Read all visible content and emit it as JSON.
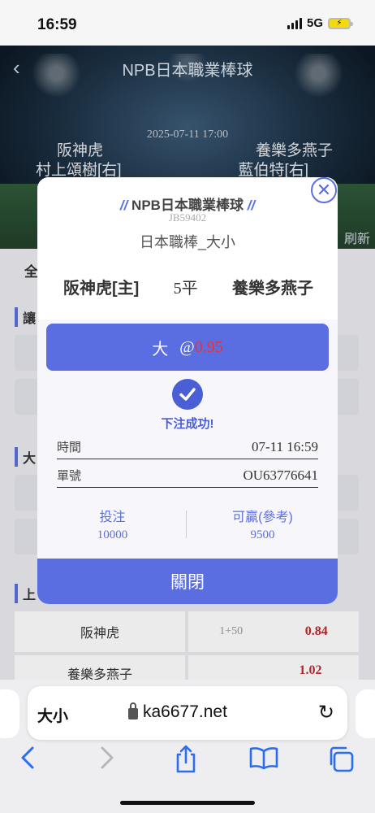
{
  "status": {
    "time": "16:59",
    "network": "5G"
  },
  "header": {
    "title": "NPB日本職業棒球",
    "date": "2025-07-11 17:00",
    "home_team": "阪神虎",
    "home_pitcher": "村上頌樹[右]",
    "away_team": "養樂多燕子",
    "away_pitcher": "藍伯特[右]",
    "refresh": "刷新"
  },
  "page": {
    "tab_all": "全",
    "section1": "讓",
    "section2": "大",
    "section3": "上",
    "row1": {
      "team": "阪神虎",
      "handicap": "1+50",
      "odds": "0.84"
    },
    "row2": {
      "team": "養樂多燕子",
      "odds": "1.02"
    }
  },
  "modal": {
    "league": "NPB日本職業棒球",
    "code": "JB59402",
    "market": "日本職棒_大小",
    "home": "阪神虎[主]",
    "line": "5平",
    "away": "養樂多燕子",
    "selection": "大",
    "at": "@",
    "odds": "0.95",
    "success": "下注成功!",
    "time_label": "時間",
    "time_value": "07-11 16:59",
    "order_label": "單號",
    "order_value": "OU63776641",
    "stake_label": "投注",
    "stake_value": "10000",
    "win_label": "可贏(參考)",
    "win_value": "9500",
    "close_label": "關閉"
  },
  "browser": {
    "aa_label": "大小",
    "url": "ka6677.net"
  },
  "colors": {
    "accent": "#5b6ee1",
    "odds_red": "#e7303a"
  }
}
